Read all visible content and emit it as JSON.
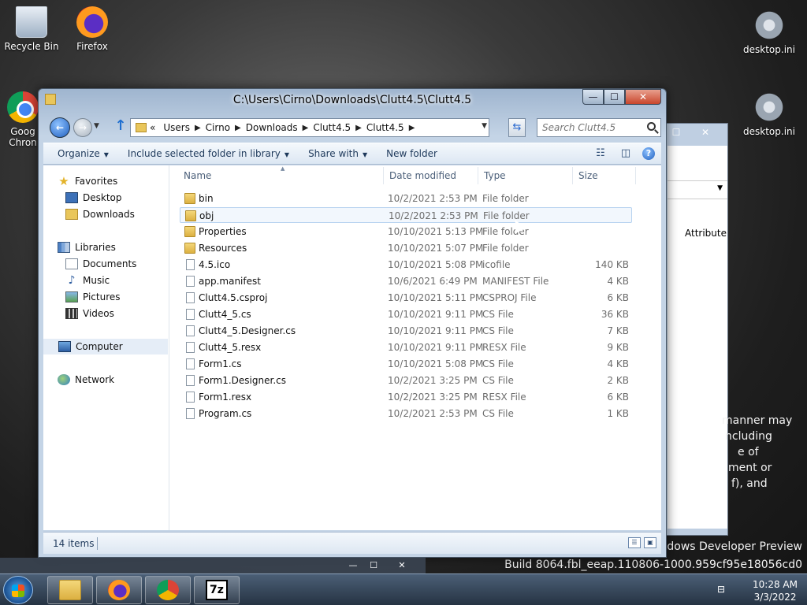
{
  "desktop": {
    "icons": [
      {
        "label": "Recycle Bin",
        "icon": "recycle-bin-icon"
      },
      {
        "label": "Firefox",
        "icon": "firefox-icon"
      },
      {
        "label": "Goog\nChron",
        "icon": "chrome-icon"
      },
      {
        "label": "desktop.ini",
        "icon": "ini-file-icon"
      },
      {
        "label": "desktop.ini",
        "icon": "ini-file-icon"
      }
    ],
    "bg_text": [
      "manner may",
      "ncluding",
      "e of",
      "ment or",
      "f), and"
    ],
    "watermark_line1": "ndows Developer Preview",
    "watermark_line2": "Build 8064.fbl_eeap.110806-1000.959cf95e18056cd0",
    "bg_window_column": "Attribute"
  },
  "window": {
    "title": "C:\\Users\\Cirno\\Downloads\\Clutt4.5\\Clutt4.5",
    "caption": {
      "minimize": "—",
      "maximize": "☐",
      "close": "✕"
    },
    "breadcrumb": [
      "«",
      "Users",
      "Cirno",
      "Downloads",
      "Clutt4.5",
      "Clutt4.5"
    ],
    "search_placeholder": "Search Clutt4.5",
    "toolbar": {
      "organize": "Organize",
      "include_library": "Include selected folder in library",
      "share_with": "Share with",
      "new_folder": "New folder"
    },
    "nav": {
      "favorites": "Favorites",
      "desktop": "Desktop",
      "downloads": "Downloads",
      "libraries": "Libraries",
      "documents": "Documents",
      "music": "Music",
      "pictures": "Pictures",
      "videos": "Videos",
      "computer": "Computer",
      "network": "Network"
    },
    "columns": {
      "name": "Name",
      "date": "Date modified",
      "type": "Type",
      "size": "Size"
    },
    "files": [
      {
        "name": "bin",
        "date": "10/2/2021 2:53 PM",
        "type": "File folder",
        "size": "",
        "kind": "folder"
      },
      {
        "name": "obj",
        "date": "10/2/2021 2:53 PM",
        "type": "File folder",
        "size": "",
        "kind": "folder"
      },
      {
        "name": "Properties",
        "date": "10/10/2021 5:13 PM",
        "type": "File folder",
        "size": "",
        "kind": "folder"
      },
      {
        "name": "Resources",
        "date": "10/10/2021 5:07 PM",
        "type": "File folder",
        "size": "",
        "kind": "folder"
      },
      {
        "name": "4.5.ico",
        "date": "10/10/2021 5:08 PM",
        "type": "icofile",
        "size": "140 KB",
        "kind": "file"
      },
      {
        "name": "app.manifest",
        "date": "10/6/2021 6:49 PM",
        "type": "MANIFEST File",
        "size": "4 KB",
        "kind": "file"
      },
      {
        "name": "Clutt4.5.csproj",
        "date": "10/10/2021 5:11 PM",
        "type": "CSPROJ File",
        "size": "6 KB",
        "kind": "file"
      },
      {
        "name": "Clutt4_5.cs",
        "date": "10/10/2021 9:11 PM",
        "type": "CS File",
        "size": "36 KB",
        "kind": "file"
      },
      {
        "name": "Clutt4_5.Designer.cs",
        "date": "10/10/2021 9:11 PM",
        "type": "CS File",
        "size": "7 KB",
        "kind": "file"
      },
      {
        "name": "Clutt4_5.resx",
        "date": "10/10/2021 9:11 PM",
        "type": "RESX File",
        "size": "9 KB",
        "kind": "file"
      },
      {
        "name": "Form1.cs",
        "date": "10/10/2021 5:08 PM",
        "type": "CS File",
        "size": "4 KB",
        "kind": "file"
      },
      {
        "name": "Form1.Designer.cs",
        "date": "10/2/2021 3:25 PM",
        "type": "CS File",
        "size": "2 KB",
        "kind": "file"
      },
      {
        "name": "Form1.resx",
        "date": "10/2/2021 3:25 PM",
        "type": "RESX File",
        "size": "6 KB",
        "kind": "file"
      },
      {
        "name": "Program.cs",
        "date": "10/2/2021 2:53 PM",
        "type": "CS File",
        "size": "1 KB",
        "kind": "file"
      }
    ],
    "status": "14 items"
  },
  "taskbar": {
    "apps": [
      "windows-explorer-icon",
      "firefox-icon",
      "chrome-icon",
      "7zip-icon"
    ],
    "seven_zip_label": "7z",
    "time": "10:28 AM",
    "date": "3/3/2022"
  }
}
